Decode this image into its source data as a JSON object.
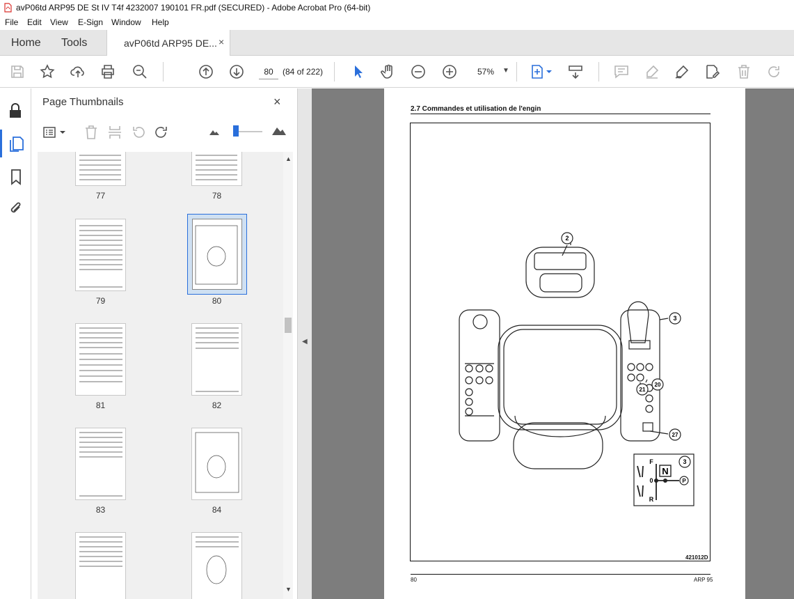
{
  "window": {
    "title": "avP06td ARP95 DE St IV T4f 4232007 190101 FR.pdf (SECURED) - Adobe Acrobat Pro (64-bit)"
  },
  "menu": [
    "File",
    "Edit",
    "View",
    "E-Sign",
    "Window",
    "Help"
  ],
  "tabs": {
    "home": "Home",
    "tools": "Tools",
    "document": "avP06td ARP95 DE...",
    "close": "×"
  },
  "toolbar": {
    "page_number": "80",
    "page_count": "(84 of 222)",
    "zoom": "57%",
    "icons": [
      "save-icon",
      "bookmark-star-icon",
      "upload-icon",
      "print-icon",
      "search-zoom-icon",
      "page-up-icon",
      "page-down-icon",
      "select-arrow-icon",
      "hand-icon",
      "zoom-out-icon",
      "zoom-in-icon",
      "fit-page-icon",
      "scroll-mode-icon",
      "comment-icon",
      "highlight-icon",
      "sign-icon",
      "fill-sign-icon",
      "delete-icon",
      "rotate-icon"
    ]
  },
  "thumbnails_panel": {
    "title": "Page Thumbnails",
    "close": "×",
    "pages": [
      "77",
      "78",
      "79",
      "80",
      "81",
      "82",
      "83",
      "84"
    ],
    "selected": "80"
  },
  "document_page": {
    "section": "2.7 Commandes et utilisation de l'engin",
    "figure_code": "421012D",
    "footer_left": "80",
    "footer_right": "ARP 95",
    "callouts": [
      "2",
      "3",
      "21",
      "20",
      "27"
    ],
    "inset": {
      "callout": "3",
      "forward": "F",
      "neutral_mark": "0",
      "reverse": "R",
      "neutral": "N",
      "park": "P"
    }
  },
  "colors": {
    "accent": "#2a6fdb",
    "doc_background": "#7d7d7d",
    "pdf_red": "#d9302c"
  }
}
